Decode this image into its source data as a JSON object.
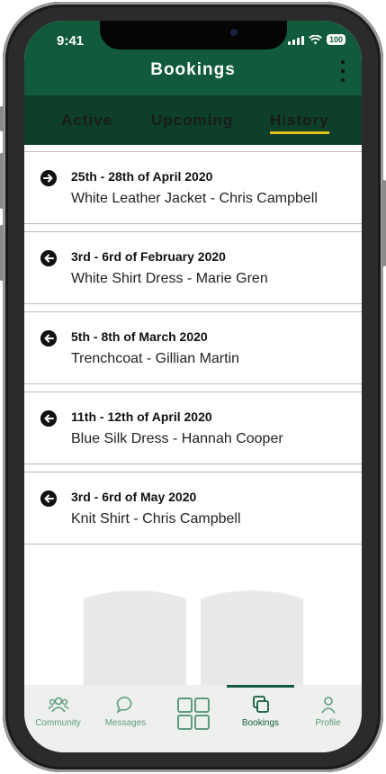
{
  "status_bar": {
    "time": "9:41",
    "battery": "100"
  },
  "header": {
    "title": "Bookings",
    "menu_icon": "kebab-menu-icon"
  },
  "tabs": [
    {
      "label": "Active"
    },
    {
      "label": "Upcoming"
    },
    {
      "label": "History",
      "active": true
    }
  ],
  "bookings": [
    {
      "dates": "25th - 28th of April 2020",
      "item": "White Leather Jacket - Chris Campbell",
      "direction": "outgoing",
      "icon": "arrow-right-icon"
    },
    {
      "dates": "3rd - 6rd of February 2020",
      "item": "White Shirt Dress - Marie Gren",
      "direction": "incoming",
      "icon": "arrow-left-icon"
    },
    {
      "dates": "5th - 8th of March 2020",
      "item": "Trenchcoat - Gillian Martin",
      "direction": "incoming",
      "icon": "arrow-left-icon"
    },
    {
      "dates": "11th - 12th of April 2020",
      "item": "Blue Silk Dress - Hannah Cooper",
      "direction": "incoming",
      "icon": "arrow-left-icon"
    },
    {
      "dates": "3rd - 6rd of May 2020",
      "item": "Knit Shirt - Chris Campbell",
      "direction": "incoming",
      "icon": "arrow-left-icon"
    }
  ],
  "bottom_nav": [
    {
      "label": "Community",
      "icon": "community-icon"
    },
    {
      "label": "Messages",
      "icon": "chat-bubble-icon"
    },
    {
      "label": "",
      "icon": "grid-icon"
    },
    {
      "label": "Bookings",
      "icon": "bookings-icon",
      "selected": true
    },
    {
      "label": "Profile",
      "icon": "profile-icon"
    }
  ],
  "colors": {
    "primary": "#115a3c",
    "tab_bar": "#0d3f2a",
    "accent": "#e4c11b",
    "nav_inactive": "#5d9a7f"
  }
}
